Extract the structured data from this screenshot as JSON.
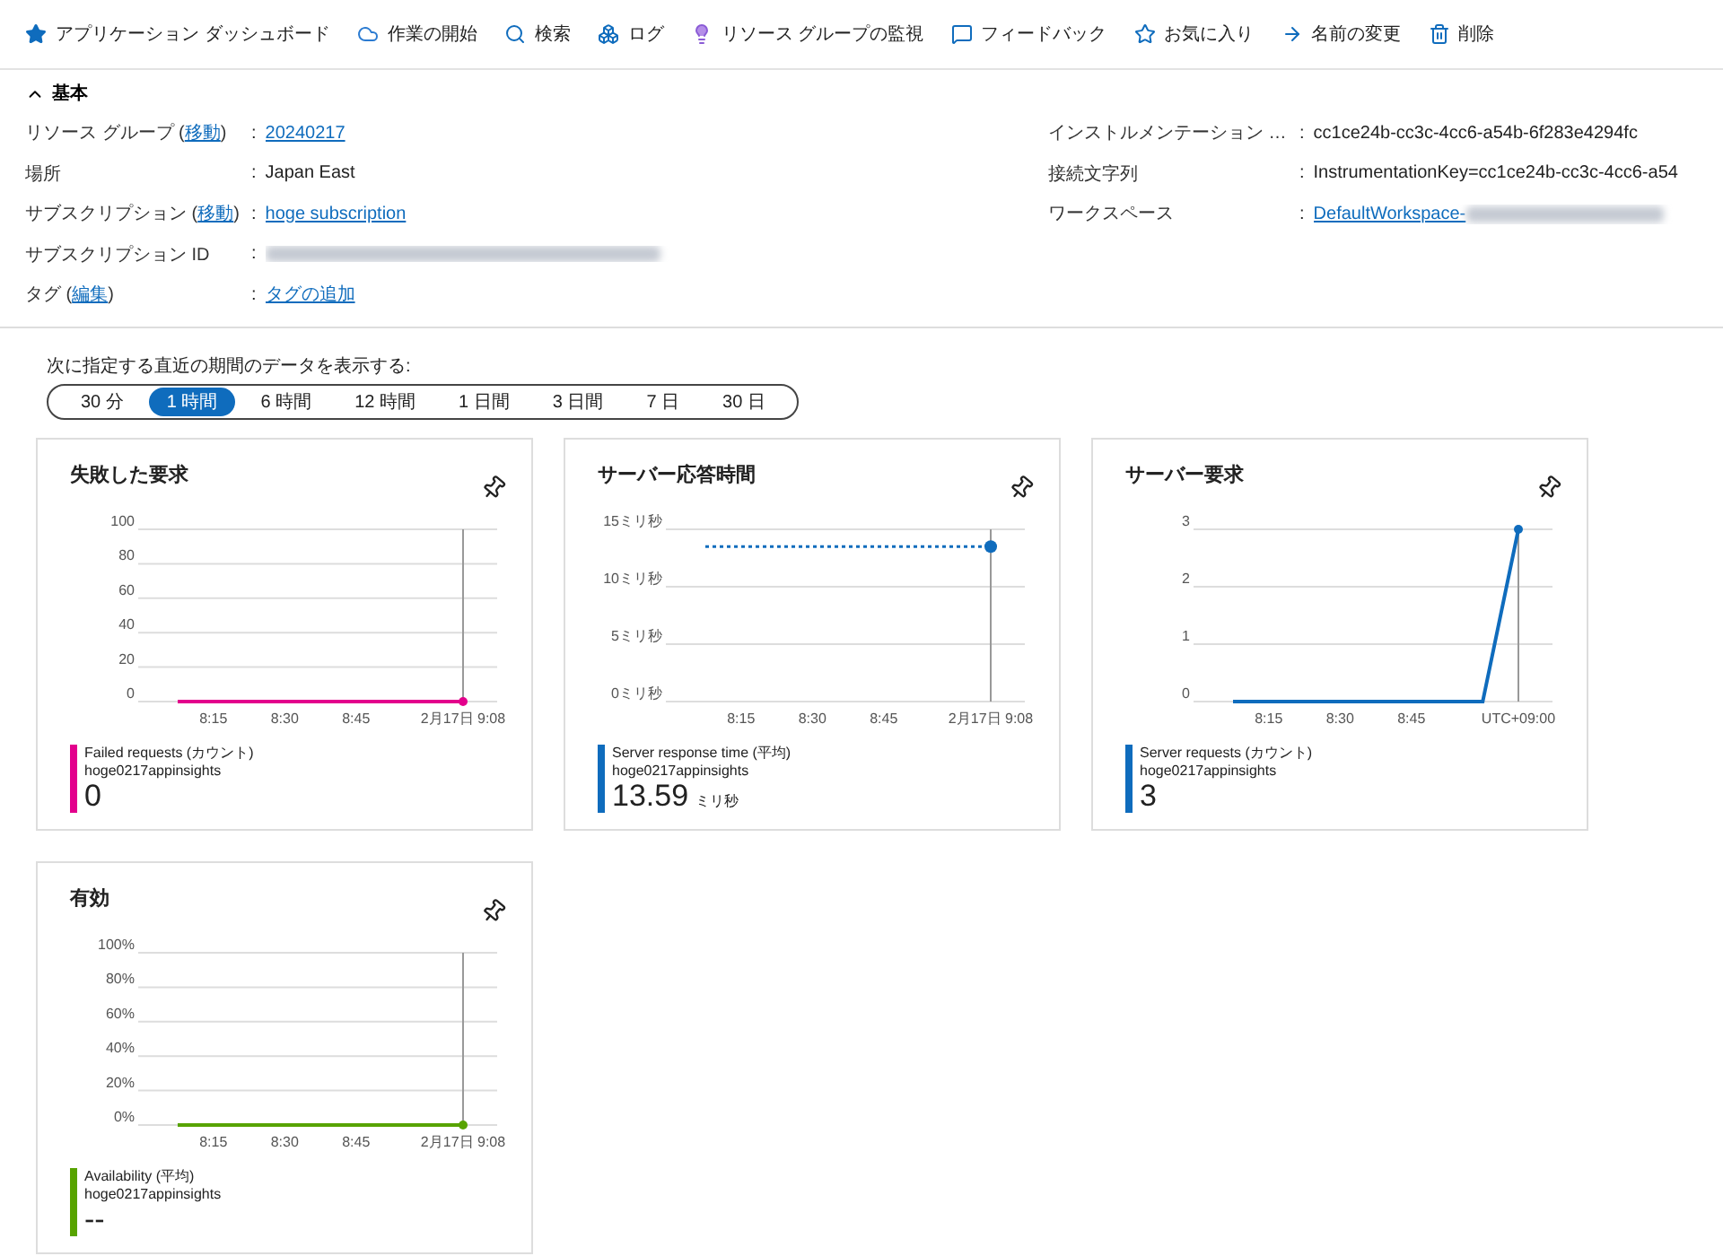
{
  "toolbar": [
    {
      "label": "アプリケーション ダッシュボード"
    },
    {
      "label": "作業の開始"
    },
    {
      "label": "検索"
    },
    {
      "label": "ログ"
    },
    {
      "label": "リソース グループの監視"
    },
    {
      "label": "フィードバック"
    },
    {
      "label": "お気に入り"
    },
    {
      "label": "名前の変更"
    },
    {
      "label": "削除"
    }
  ],
  "essentials": {
    "title": "基本",
    "expanded": true,
    "left": [
      {
        "label": "リソース グループ (",
        "label_link": "移動",
        "label_tail": ")",
        "separator": ":",
        "kind": "link",
        "value": "20240217"
      },
      {
        "label": "場所",
        "separator": ":",
        "kind": "text",
        "value": "Japan East"
      },
      {
        "label": "サブスクリプション (",
        "label_link": "移動",
        "label_tail": ")",
        "separator": ":",
        "kind": "link",
        "value": "hoge subscription"
      },
      {
        "label": "サブスクリプション ID",
        "separator": ":",
        "kind": "redacted"
      },
      {
        "label": "タグ (",
        "label_link": "編集",
        "label_tail": ")",
        "separator": ":",
        "kind": "link",
        "value": "タグの追加"
      }
    ],
    "right": [
      {
        "label": "インストルメンテーション …",
        "separator": ":",
        "kind": "text",
        "value": "cc1ce24b-cc3c-4cc6-a54b-6f283e4294fc"
      },
      {
        "label": "接続文字列",
        "separator": ":",
        "kind": "text",
        "value": "InstrumentationKey=cc1ce24b-cc3c-4cc6-a54"
      },
      {
        "label": "ワークスペース",
        "separator": ":",
        "kind": "link_redacted",
        "value": "DefaultWorkspace-"
      }
    ]
  },
  "time_range": {
    "label": "次に指定する直近の期間のデータを表示する:",
    "options": [
      {
        "label": "30 分",
        "selected": false
      },
      {
        "label": "1 時間",
        "selected": true
      },
      {
        "label": "6 時間",
        "selected": false
      },
      {
        "label": "12 時間",
        "selected": false
      },
      {
        "label": "1 日間",
        "selected": false
      },
      {
        "label": "3 日間",
        "selected": false
      },
      {
        "label": "7 日",
        "selected": false
      },
      {
        "label": "30 日",
        "selected": false
      }
    ]
  },
  "tiles": [
    {
      "title": "失敗した要求",
      "color": "#e3008c",
      "resource": "hoge0217appinsights",
      "value": "0",
      "chart_data": {
        "type": "line",
        "grid": true,
        "categories": [
          null,
          "8:15",
          null,
          "8:30",
          null,
          "8:45",
          null,
          null,
          "2月17日 9:08"
        ],
        "series": [
          {
            "name": "Failed requests (カウント)",
            "color": "#e3008c",
            "values": [
              0,
              0,
              0,
              0,
              0,
              0,
              0,
              0,
              0
            ]
          }
        ],
        "ylim": [
          0,
          100
        ],
        "yticks": [
          0,
          20,
          40,
          60,
          80,
          100
        ]
      }
    },
    {
      "title": "サーバー応答時間",
      "color": "#0f6cbd",
      "resource": "hoge0217appinsights",
      "value": "13.59",
      "unit": "ミリ秒",
      "chart_data": {
        "type": "line",
        "grid": true,
        "categories": [
          null,
          "8:15",
          null,
          "8:30",
          null,
          "8:45",
          null,
          null,
          "2月17日 9:08"
        ],
        "series": [
          {
            "name": "Server response time (平均)",
            "color": "#0f6cbd",
            "values": [
              13.5,
              13.5,
              13.5,
              13.5,
              13.5,
              13.5,
              13.5,
              13.5,
              13.5
            ],
            "line_style": "dotted"
          }
        ],
        "ylim": [
          0,
          15
        ],
        "yticks": [
          {
            "value": 0,
            "label": "0ミリ秒"
          },
          {
            "value": 5,
            "label": "5ミリ秒"
          },
          {
            "value": 10,
            "label": "10ミリ秒"
          },
          {
            "value": 15,
            "label": "15ミリ秒"
          }
        ]
      }
    },
    {
      "title": "サーバー要求",
      "color": "#0f6cbd",
      "resource": "hoge0217appinsights",
      "value": "3",
      "chart_data": {
        "type": "line",
        "grid": true,
        "categories": [
          null,
          "8:15",
          null,
          "8:30",
          null,
          "8:45",
          null,
          null,
          "UTC+09:00"
        ],
        "series": [
          {
            "name": "Server requests (カウント)",
            "color": "#0f6cbd",
            "values": [
              0,
              0,
              0,
              0,
              0,
              0,
              0,
              0,
              3
            ]
          }
        ],
        "ylim": [
          0,
          3
        ],
        "yticks": [
          0,
          1,
          2,
          3
        ]
      }
    },
    {
      "title": "有効",
      "color": "#57a300",
      "resource": "hoge0217appinsights",
      "value": "--",
      "chart_data": {
        "type": "line",
        "grid": true,
        "categories": [
          null,
          "8:15",
          null,
          "8:30",
          null,
          "8:45",
          null,
          null,
          "2月17日 9:08"
        ],
        "series": [
          {
            "name": "Availability (平均)",
            "color": "#57a300",
            "values": [
              0,
              0,
              0,
              0,
              0,
              0,
              0,
              0,
              0
            ]
          }
        ],
        "ylim": [
          0,
          100
        ],
        "yticks": [
          {
            "value": 0,
            "label": "0%"
          },
          {
            "value": 20,
            "label": "20%"
          },
          {
            "value": 40,
            "label": "40%"
          },
          {
            "value": 60,
            "label": "60%"
          },
          {
            "value": 80,
            "label": "80%"
          },
          {
            "value": 100,
            "label": "100%"
          }
        ]
      }
    }
  ]
}
